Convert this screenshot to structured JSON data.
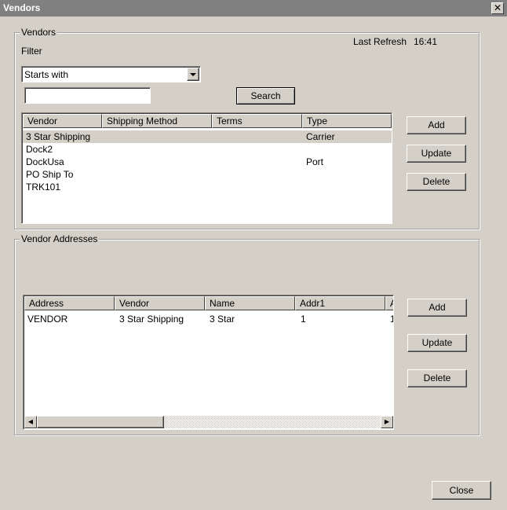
{
  "window": {
    "title": "Vendors",
    "close_glyph": "✕"
  },
  "vendors_group": {
    "legend": "Vendors",
    "last_refresh_label": "Last Refresh",
    "last_refresh_time": "16:41",
    "filter_label": "Filter",
    "filter_select_value": "Starts with",
    "search_input_value": "",
    "search_button": "Search",
    "columns": [
      "Vendor",
      "Shipping Method",
      "Terms",
      "Type"
    ],
    "rows": [
      {
        "vendor": "3 Star Shipping",
        "shipping_method": "",
        "terms": "",
        "type": "Carrier"
      },
      {
        "vendor": "Dock2",
        "shipping_method": "",
        "terms": "",
        "type": ""
      },
      {
        "vendor": "DockUsa",
        "shipping_method": "",
        "terms": "",
        "type": "Port"
      },
      {
        "vendor": "PO Ship To",
        "shipping_method": "",
        "terms": "",
        "type": ""
      },
      {
        "vendor": "TRK101",
        "shipping_method": "",
        "terms": "",
        "type": ""
      }
    ],
    "buttons": {
      "add": "Add",
      "update": "Update",
      "delete": "Delete"
    }
  },
  "addresses_group": {
    "legend": "Vendor Addresses",
    "columns": [
      "Address",
      "Vendor",
      "Name",
      "Addr1",
      "A"
    ],
    "rows": [
      {
        "address": "VENDOR",
        "vendor": "3 Star Shipping",
        "name": "3 Star",
        "addr1": "1",
        "a": "1"
      }
    ],
    "buttons": {
      "add": "Add",
      "update": "Update",
      "delete": "Delete"
    }
  },
  "footer": {
    "close_button": "Close"
  },
  "colors": {
    "window_bg": "#d4d0c8",
    "titlebar_bg": "#808080",
    "selected_row_bg": "#d4d0c8"
  }
}
